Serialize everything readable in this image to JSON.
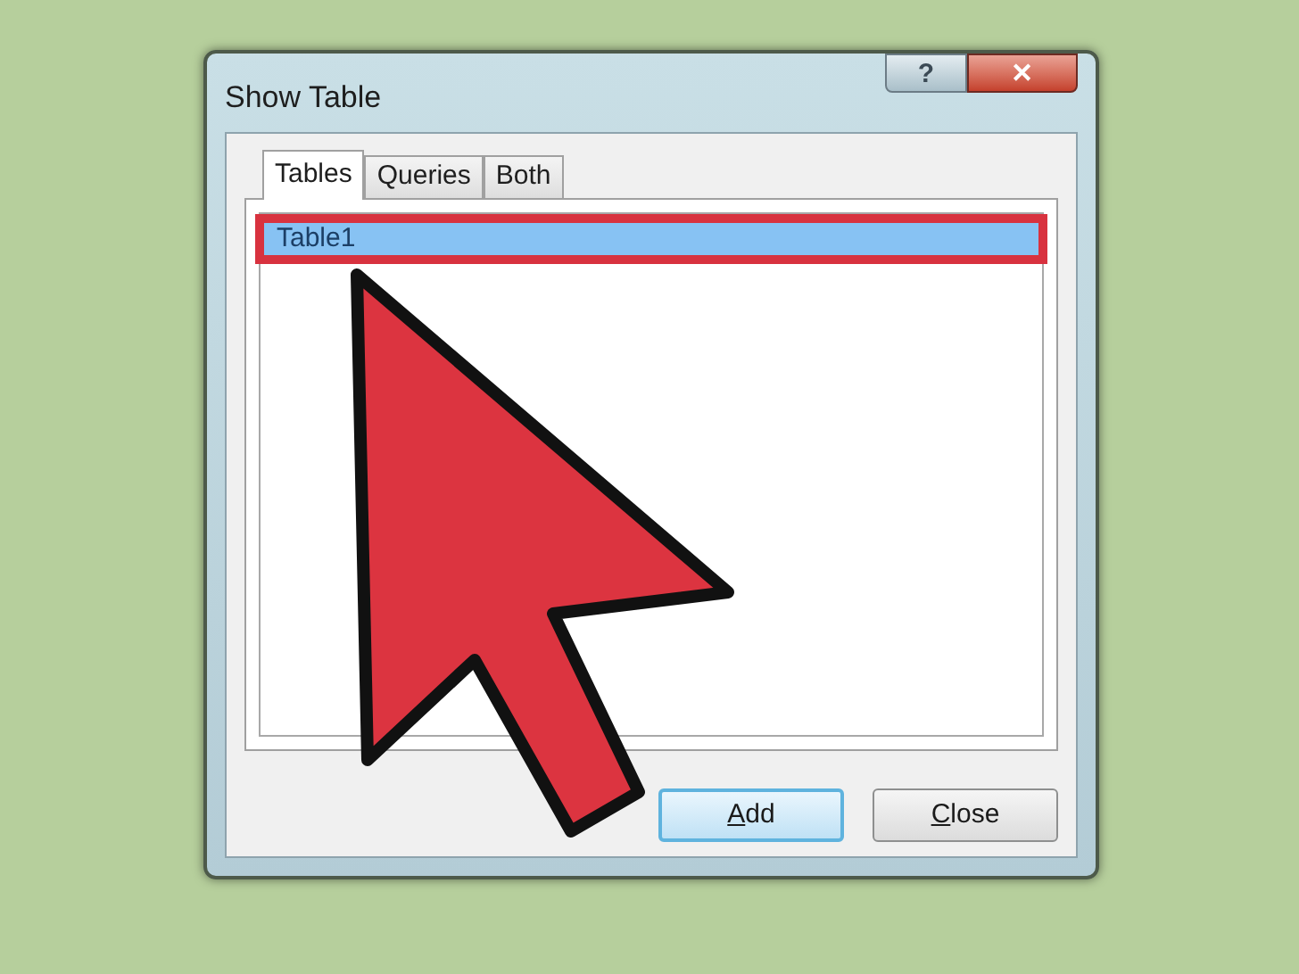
{
  "window": {
    "title": "Show Table",
    "help_button": "?",
    "close_button": "✕"
  },
  "tabs": [
    {
      "label": "Tables",
      "selected": true
    },
    {
      "label": "Queries",
      "selected": false
    },
    {
      "label": "Both",
      "selected": false
    }
  ],
  "list": {
    "items": [
      {
        "label": "Table1",
        "selected": true
      }
    ]
  },
  "buttons": [
    {
      "label": "Add",
      "default": true
    },
    {
      "label": "Close",
      "default": false
    }
  ]
}
